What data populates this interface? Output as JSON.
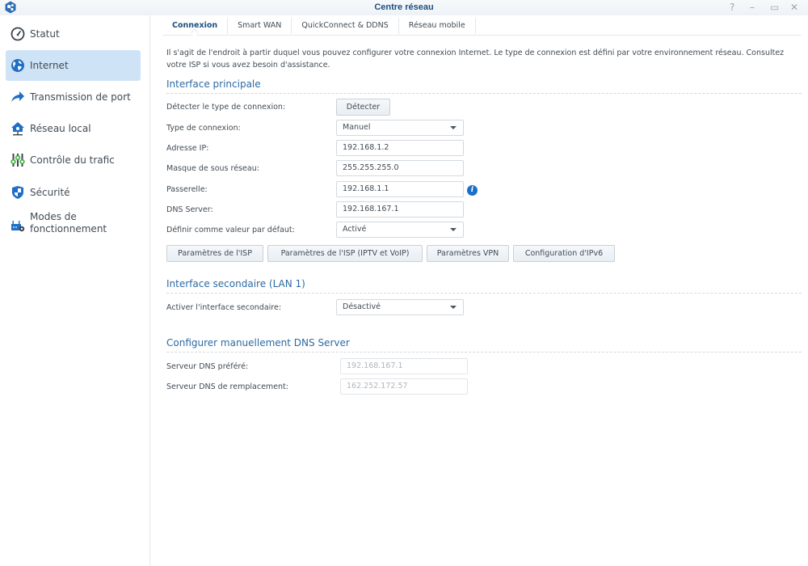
{
  "window": {
    "title": "Centre réseau",
    "controls": {
      "help": "?",
      "minimize": "–",
      "maximize": "▭",
      "close": "✕"
    }
  },
  "sidebar": {
    "items": [
      {
        "label": "Statut",
        "icon": "gauge-icon",
        "active": false
      },
      {
        "label": "Internet",
        "icon": "globe-icon",
        "active": true
      },
      {
        "label": "Transmission de port",
        "icon": "forward-arrow-icon",
        "active": false
      },
      {
        "label": "Réseau local",
        "icon": "home-network-icon",
        "active": false
      },
      {
        "label": "Contrôle du trafic",
        "icon": "sliders-icon",
        "active": false
      },
      {
        "label": "Sécurité",
        "icon": "shield-icon",
        "active": false
      },
      {
        "label": "Modes de fonctionnement",
        "icon": "router-gear-icon",
        "active": false
      }
    ]
  },
  "tabs": [
    {
      "label": "Connexion",
      "active": true
    },
    {
      "label": "Smart WAN",
      "active": false
    },
    {
      "label": "QuickConnect & DDNS",
      "active": false
    },
    {
      "label": "Réseau mobile",
      "active": false
    }
  ],
  "description": "Il s'agit de l'endroit à partir duquel vous pouvez configurer votre connexion Internet. Le type de connexion est défini par votre environnement réseau. Consultez votre ISP si vous avez besoin d'assistance.",
  "primary": {
    "title": "Interface principale",
    "detect_label": "Détecter le type de connexion:",
    "detect_button": "Détecter",
    "conn_type_label": "Type de connexion:",
    "conn_type_value": "Manuel",
    "ip_label": "Adresse IP:",
    "ip_value": "192.168.1.2",
    "mask_label": "Masque de sous réseau:",
    "mask_value": "255.255.255.0",
    "gateway_label": "Passerelle:",
    "gateway_value": "192.168.1.1",
    "dns_label": "DNS Server:",
    "dns_value": "192.168.167.1",
    "default_label": "Définir comme valeur par défaut:",
    "default_value": "Activé",
    "buttons": [
      "Paramètres de l'ISP",
      "Paramètres de l'ISP (IPTV et VoIP)",
      "Paramètres VPN",
      "Configuration d'IPv6"
    ]
  },
  "secondary": {
    "title": "Interface secondaire (LAN 1)",
    "enable_label": "Activer l'interface secondaire:",
    "enable_value": "Désactivé"
  },
  "dns_manual": {
    "title": "Configurer manuellement DNS Server",
    "preferred_label": "Serveur DNS préféré:",
    "preferred_value": "192.168.167.1",
    "alternate_label": "Serveur DNS de remplacement:",
    "alternate_value": "162.252.172.57"
  },
  "colors": {
    "accent": "#2d6aa3",
    "active_item_bg": "#cfe3f6",
    "info": "#1a6fc9"
  }
}
